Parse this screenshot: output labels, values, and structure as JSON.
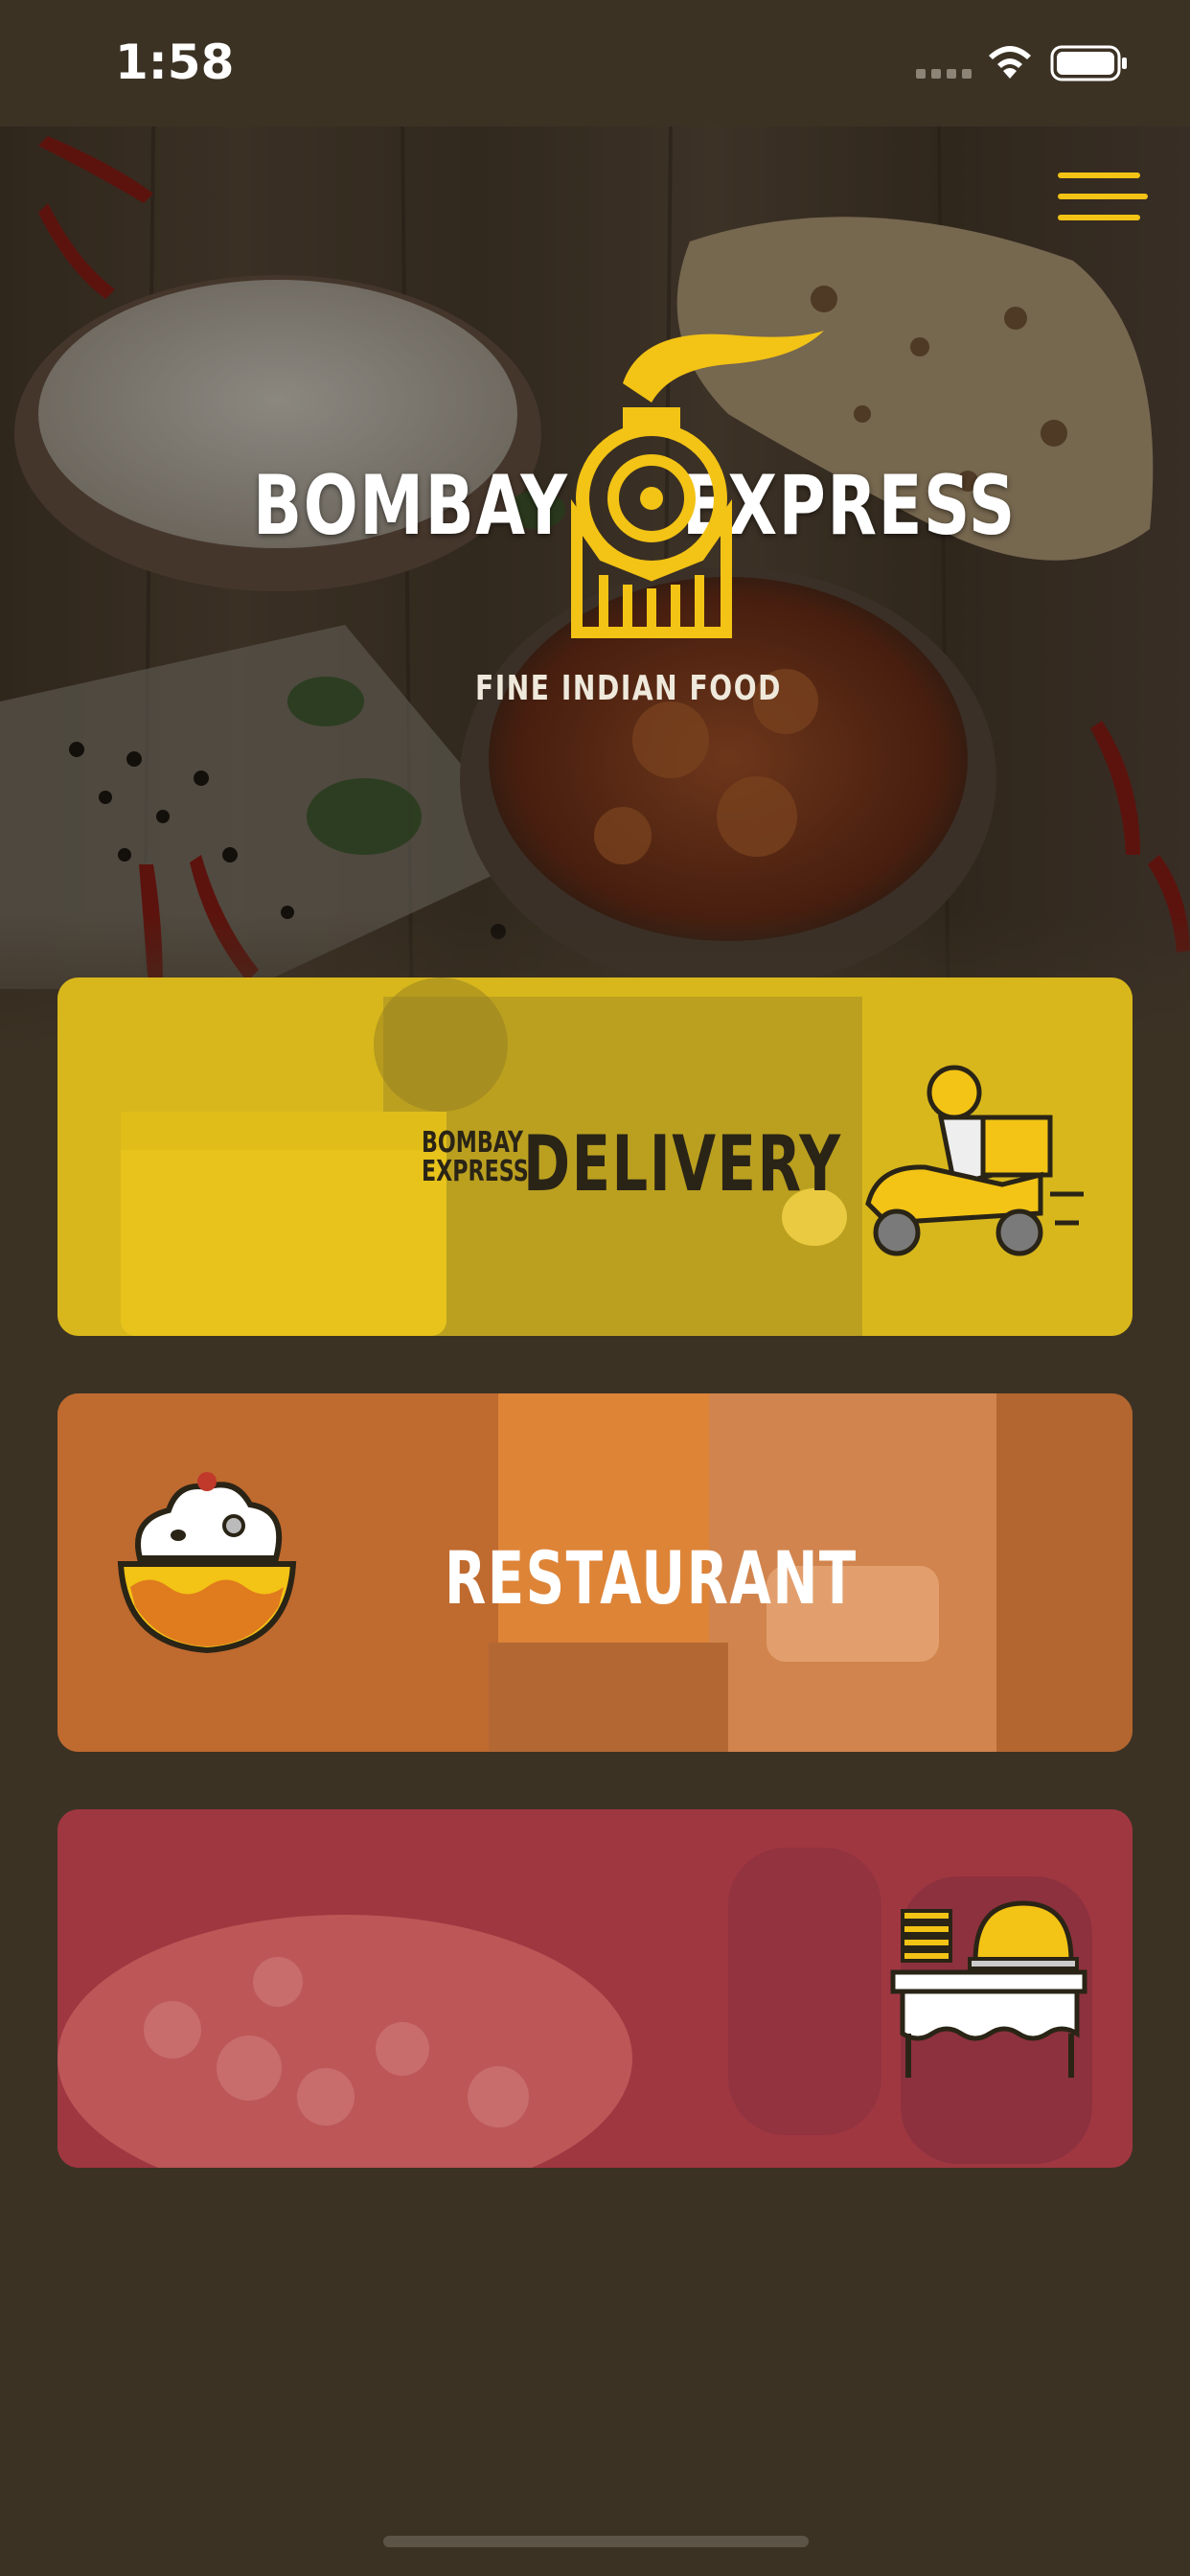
{
  "status_bar": {
    "time": "1:58",
    "icons": [
      "signal-icon",
      "wifi-icon",
      "battery-icon"
    ]
  },
  "header": {
    "menu_icon": "hamburger-menu-icon",
    "brand_left": "BOMBAY",
    "brand_right": "EXPRESS",
    "tagline": "FINE INDIAN FOOD",
    "logo_icon": "train-engine-icon"
  },
  "cards": {
    "delivery": {
      "brand_line1": "BOMBAY",
      "brand_line2": "EXPRESS",
      "title": "DELIVERY",
      "icon": "scooter-delivery-icon",
      "color": "#e3c21c"
    },
    "restaurant": {
      "title": "RESTAURANT",
      "icon": "rice-bowl-icon",
      "color": "#e0782d"
    },
    "catering": {
      "icon": "catering-buffet-icon",
      "color": "#b73a48"
    }
  },
  "colors": {
    "background": "#3c3224",
    "accent": "#f3c315"
  }
}
